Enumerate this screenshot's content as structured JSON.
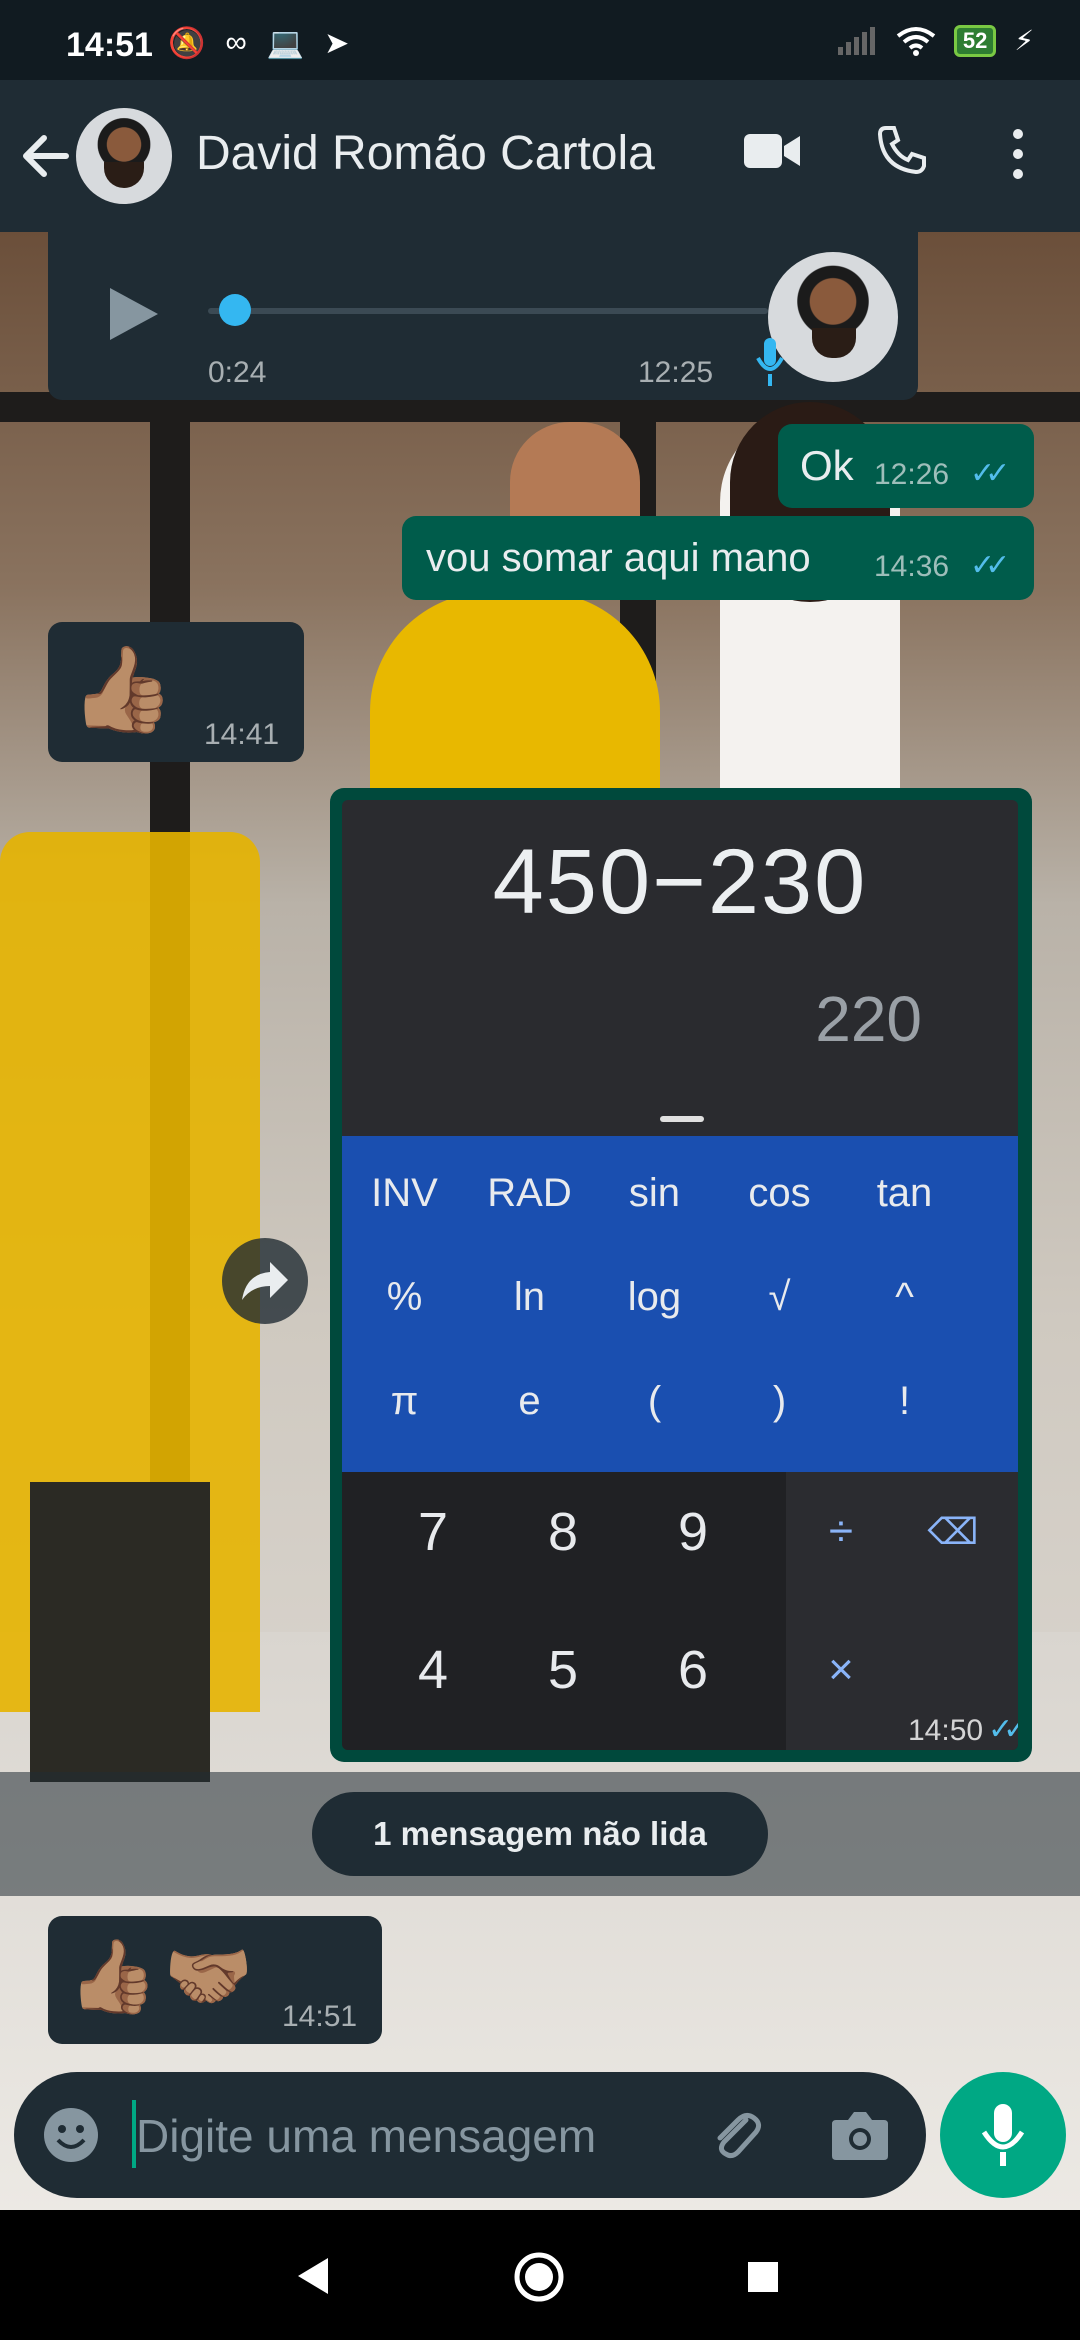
{
  "status_bar": {
    "time": "14:51",
    "battery": "52"
  },
  "header": {
    "contact_name": "David Romão Cartola"
  },
  "messages": {
    "voice": {
      "duration": "0:24",
      "time": "12:25",
      "progress": 0.02
    },
    "ok": {
      "text": "Ok",
      "time": "12:26"
    },
    "somar": {
      "text": "vou somar aqui mano",
      "time": "14:36"
    },
    "thumb": {
      "emoji": "👍🏽",
      "time": "14:41"
    },
    "calc_image": {
      "time": "14:50"
    },
    "last": {
      "emoji": "👍🏽🤝🏽",
      "time": "14:51"
    }
  },
  "calculator": {
    "expression": "450−230",
    "result": "220",
    "sci_rows": [
      [
        "INV",
        "RAD",
        "sin",
        "cos",
        "tan"
      ],
      [
        "%",
        "ln",
        "log",
        "√",
        "^"
      ],
      [
        "π",
        "e",
        "(",
        ")",
        "!"
      ]
    ],
    "num_rows": [
      [
        "7",
        "8",
        "9"
      ],
      [
        "4",
        "5",
        "6"
      ]
    ],
    "ops": [
      "÷",
      "⌫",
      "×"
    ]
  },
  "unread_label": "1 mensagem não lida",
  "composer": {
    "placeholder": "Digite uma mensagem"
  },
  "colors": {
    "header_bg": "#1f2c34",
    "outgoing_bubble": "#005c4b",
    "incoming_bubble": "#1f2c34",
    "accent": "#00a884",
    "ticks": "#53bdeb",
    "calc_sci": "#1a4fb0"
  },
  "icons": [
    "back-arrow-icon",
    "video-call-icon",
    "phone-icon",
    "more-vert-icon",
    "play-icon",
    "mic-icon",
    "forward-icon",
    "emoji-icon",
    "attach-icon",
    "camera-icon",
    "nav-back-icon",
    "nav-home-icon",
    "nav-recents-icon"
  ]
}
